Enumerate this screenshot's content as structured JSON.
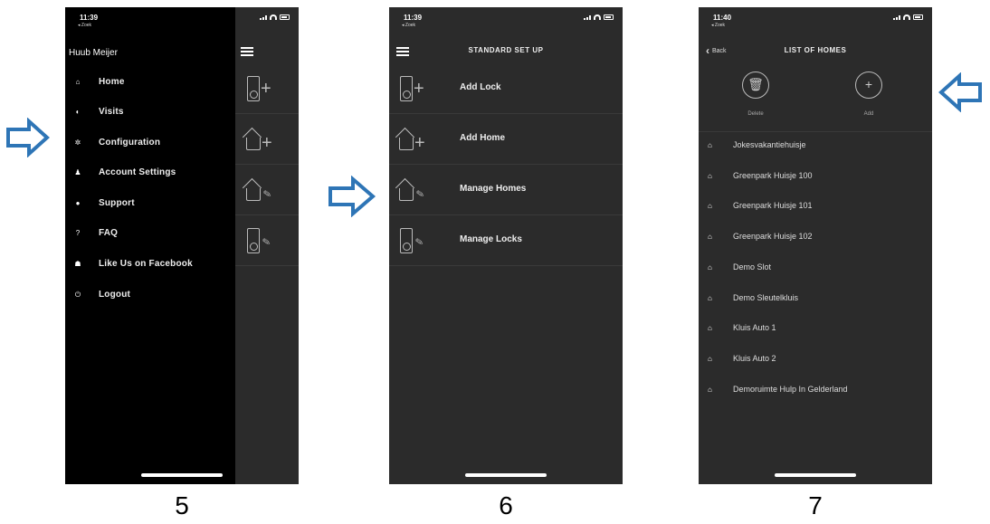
{
  "steps": [
    "5",
    "6",
    "7"
  ],
  "screen5": {
    "time": "11:39",
    "back_app": "◂ Zoek",
    "user_name": "Huub Meijer",
    "menu": [
      {
        "icon": "home-icon",
        "glyph": "⌂",
        "label": "Home"
      },
      {
        "icon": "visits-icon",
        "glyph": "◐",
        "label": "Visits"
      },
      {
        "icon": "gear-icon",
        "glyph": "✲",
        "label": "Configuration"
      },
      {
        "icon": "person-icon",
        "glyph": "♟",
        "label": "Account Settings"
      },
      {
        "icon": "info-icon",
        "glyph": "●",
        "label": "Support"
      },
      {
        "icon": "question-icon",
        "glyph": "?",
        "label": "FAQ"
      },
      {
        "icon": "thumbs-up-icon",
        "glyph": "☗",
        "label": "Like Us on Facebook"
      },
      {
        "icon": "logout-icon",
        "glyph": "⏻",
        "label": "Logout"
      }
    ]
  },
  "screen6": {
    "time": "11:39",
    "back_app": "◂ Zoek",
    "title": "STANDARD SET UP",
    "rows": [
      {
        "icon": "add-lock-icon",
        "label": "Add Lock"
      },
      {
        "icon": "add-home-icon",
        "label": "Add Home"
      },
      {
        "icon": "manage-homes-icon",
        "label": "Manage Homes"
      },
      {
        "icon": "manage-locks-icon",
        "label": "Manage Locks"
      }
    ]
  },
  "screen7": {
    "time": "11:40",
    "back_app": "◂ Zoek",
    "back_label": "Back",
    "title": "LIST OF HOMES",
    "delete_label": "Delete",
    "add_label": "Add",
    "homes": [
      "Jokesvakantiehuisje",
      "Greenpark Huisje 100",
      "Greenpark Huisje 101",
      "Greenpark Huisje 102",
      "Demo Slot",
      "Demo Sleutelkluis",
      "Kluis Auto 1",
      "Kluis Auto 2",
      "Demoruimte Hulp In Gelderland"
    ]
  },
  "colors": {
    "arrow": "#2e75b6",
    "screen_bg": "#2b2b2b",
    "drawer_bg": "#000000"
  }
}
